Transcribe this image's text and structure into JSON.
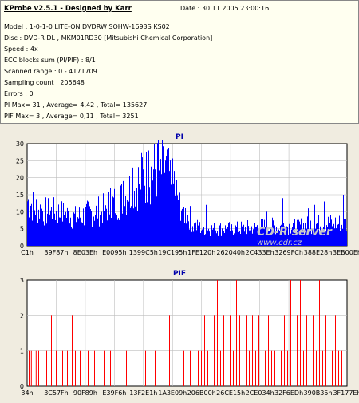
{
  "header": {
    "title": "KProbe v2.5.1 - Designed by Karr",
    "date": "Date : 30.11.2005 23:00:16",
    "lines": [
      "Model : 1-0-1-0 LITE-ON DVDRW SOHW-1693S KS02",
      "Disc : DVD-R DL , MKM01RD30 [Mitsubishi Chemical Corporation]",
      "Speed : 4x",
      "ECC blocks sum (PI/PIF) : 8/1",
      "Scanned range : 0 - 4171709",
      "Sampling count : 205648",
      "Errors : 0",
      "PI Max= 31 , Average= 4,42 , Total= 135627",
      "PIF Max= 3 , Average= 0,11 , Total= 3251"
    ]
  },
  "watermark": {
    "text": "CD-R server",
    "url": "www.cdr.cz"
  },
  "colors": {
    "series": "#0000ff",
    "pif": "#ff0000",
    "grid": "#bdbdbd"
  },
  "chart_data": [
    {
      "type": "bar",
      "title": "PI",
      "ylim": [
        0,
        30
      ],
      "yticks": [
        0,
        5,
        10,
        15,
        20,
        25,
        30
      ],
      "xtick_labels": [
        "C1h",
        "39F87h",
        "8E03Eh",
        "E0095h",
        "1399C5h",
        "19C195h",
        "1FE120h",
        "262040h",
        "2C433Eh",
        "3269FCh",
        "388E28h",
        "3EB00Eh"
      ],
      "grid": true,
      "envelope": [
        [
          0,
          16
        ],
        [
          0.03,
          13
        ],
        [
          0.06,
          12
        ],
        [
          0.09,
          12
        ],
        [
          0.12,
          11
        ],
        [
          0.15,
          10
        ],
        [
          0.18,
          11
        ],
        [
          0.21,
          12
        ],
        [
          0.24,
          13
        ],
        [
          0.27,
          15
        ],
        [
          0.3,
          17
        ],
        [
          0.33,
          21
        ],
        [
          0.36,
          24
        ],
        [
          0.39,
          26
        ],
        [
          0.41,
          27
        ],
        [
          0.43,
          26
        ],
        [
          0.45,
          23
        ],
        [
          0.47,
          18
        ],
        [
          0.49,
          12
        ],
        [
          0.51,
          10
        ],
        [
          0.52,
          7
        ],
        [
          0.56,
          6
        ],
        [
          0.65,
          6
        ],
        [
          0.75,
          7
        ],
        [
          0.85,
          7
        ],
        [
          0.92,
          8
        ],
        [
          1.0,
          8
        ]
      ],
      "peaks": [
        {
          "x": 0.41,
          "y": 31
        },
        {
          "x": 0.38,
          "y": 28
        },
        {
          "x": 0.36,
          "y": 26
        },
        {
          "x": 0.02,
          "y": 25
        },
        {
          "x": 0.26,
          "y": 17
        },
        {
          "x": 0.3,
          "y": 19
        },
        {
          "x": 0.99,
          "y": 15
        },
        {
          "x": 0.8,
          "y": 14
        },
        {
          "x": 0.93,
          "y": 13
        },
        {
          "x": 0.88,
          "y": 11
        },
        {
          "x": 0.56,
          "y": 12
        },
        {
          "x": 0.7,
          "y": 11
        },
        {
          "x": 0.75,
          "y": 10
        },
        {
          "x": 0.9,
          "y": 12
        },
        {
          "x": 0.46,
          "y": 22
        },
        {
          "x": 0.33,
          "y": 23
        }
      ]
    },
    {
      "type": "bar",
      "title": "PIF",
      "ylim": [
        0,
        3
      ],
      "yticks": [
        0,
        1,
        2,
        3
      ],
      "xtick_labels": [
        "34h",
        "3C57Fh",
        "90F89h",
        "E39F6h",
        "13F2E1h",
        "1A3E09h",
        "206B00h",
        "26CE15h",
        "2CE034h",
        "32F6EDh",
        "390B35h",
        "3F177Eh"
      ],
      "grid": true,
      "events": [
        {
          "x": 0.005,
          "y": 1
        },
        {
          "x": 0.012,
          "y": 1
        },
        {
          "x": 0.02,
          "y": 2
        },
        {
          "x": 0.027,
          "y": 1
        },
        {
          "x": 0.035,
          "y": 1
        },
        {
          "x": 0.06,
          "y": 1
        },
        {
          "x": 0.075,
          "y": 2
        },
        {
          "x": 0.09,
          "y": 1
        },
        {
          "x": 0.11,
          "y": 1
        },
        {
          "x": 0.125,
          "y": 1
        },
        {
          "x": 0.14,
          "y": 2
        },
        {
          "x": 0.15,
          "y": 1
        },
        {
          "x": 0.165,
          "y": 1
        },
        {
          "x": 0.19,
          "y": 1
        },
        {
          "x": 0.21,
          "y": 1
        },
        {
          "x": 0.24,
          "y": 1
        },
        {
          "x": 0.26,
          "y": 1
        },
        {
          "x": 0.31,
          "y": 1
        },
        {
          "x": 0.34,
          "y": 1
        },
        {
          "x": 0.37,
          "y": 1
        },
        {
          "x": 0.4,
          "y": 1
        },
        {
          "x": 0.445,
          "y": 2
        },
        {
          "x": 0.49,
          "y": 1
        },
        {
          "x": 0.51,
          "y": 1
        },
        {
          "x": 0.525,
          "y": 2
        },
        {
          "x": 0.535,
          "y": 1
        },
        {
          "x": 0.545,
          "y": 1
        },
        {
          "x": 0.555,
          "y": 2
        },
        {
          "x": 0.565,
          "y": 1
        },
        {
          "x": 0.575,
          "y": 1
        },
        {
          "x": 0.585,
          "y": 2
        },
        {
          "x": 0.595,
          "y": 3
        },
        {
          "x": 0.605,
          "y": 1
        },
        {
          "x": 0.615,
          "y": 2
        },
        {
          "x": 0.625,
          "y": 1
        },
        {
          "x": 0.635,
          "y": 2
        },
        {
          "x": 0.645,
          "y": 1
        },
        {
          "x": 0.655,
          "y": 3
        },
        {
          "x": 0.665,
          "y": 2
        },
        {
          "x": 0.675,
          "y": 1
        },
        {
          "x": 0.685,
          "y": 2
        },
        {
          "x": 0.695,
          "y": 1
        },
        {
          "x": 0.705,
          "y": 2
        },
        {
          "x": 0.715,
          "y": 1
        },
        {
          "x": 0.725,
          "y": 2
        },
        {
          "x": 0.735,
          "y": 1
        },
        {
          "x": 0.745,
          "y": 1
        },
        {
          "x": 0.755,
          "y": 2
        },
        {
          "x": 0.765,
          "y": 1
        },
        {
          "x": 0.775,
          "y": 1
        },
        {
          "x": 0.785,
          "y": 2
        },
        {
          "x": 0.795,
          "y": 1
        },
        {
          "x": 0.805,
          "y": 2
        },
        {
          "x": 0.815,
          "y": 1
        },
        {
          "x": 0.825,
          "y": 3
        },
        {
          "x": 0.835,
          "y": 1
        },
        {
          "x": 0.845,
          "y": 2
        },
        {
          "x": 0.855,
          "y": 3
        },
        {
          "x": 0.865,
          "y": 1
        },
        {
          "x": 0.875,
          "y": 2
        },
        {
          "x": 0.885,
          "y": 1
        },
        {
          "x": 0.895,
          "y": 2
        },
        {
          "x": 0.905,
          "y": 1
        },
        {
          "x": 0.915,
          "y": 3
        },
        {
          "x": 0.925,
          "y": 1
        },
        {
          "x": 0.935,
          "y": 2
        },
        {
          "x": 0.945,
          "y": 1
        },
        {
          "x": 0.955,
          "y": 1
        },
        {
          "x": 0.965,
          "y": 2
        },
        {
          "x": 0.975,
          "y": 1
        },
        {
          "x": 0.985,
          "y": 1
        },
        {
          "x": 0.995,
          "y": 2
        }
      ]
    }
  ]
}
